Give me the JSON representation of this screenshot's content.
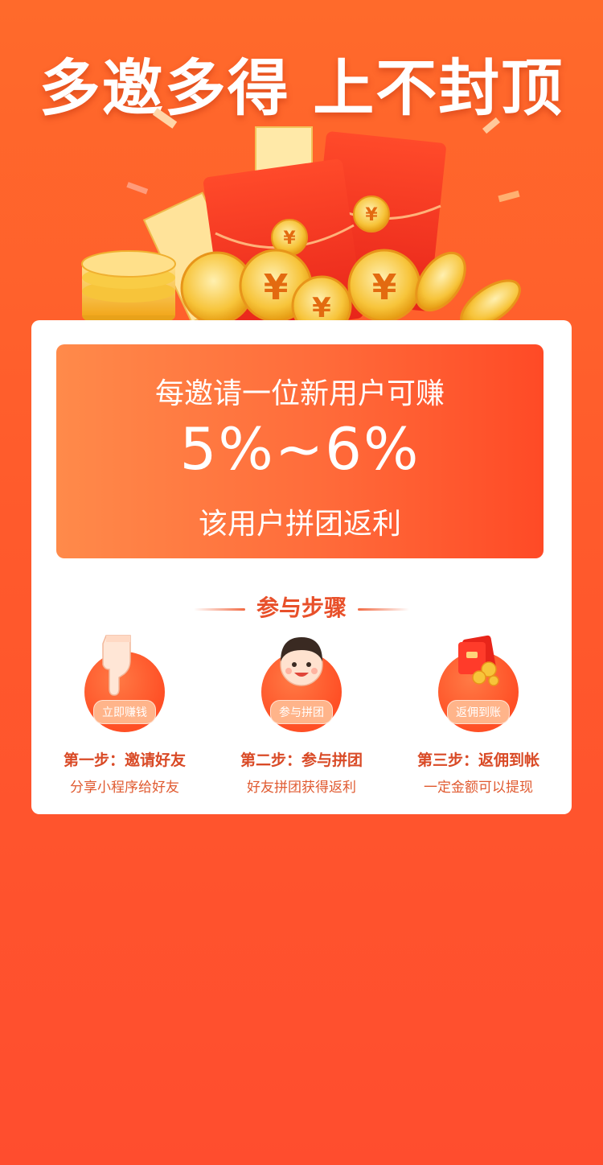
{
  "headline": "多邀多得 上不封顶",
  "banner": {
    "line1": "每邀请一位新用户可赚",
    "rate": "5%~6%",
    "line3": "该用户拼团返利"
  },
  "steps": {
    "title": "参与步骤",
    "items": [
      {
        "badge": "立即赚钱",
        "title": "第一步：邀请好友",
        "desc": "分享小程序给好友",
        "icon": "pointing-hand-icon"
      },
      {
        "badge": "参与拼团",
        "title": "第二步：参与拼团",
        "desc": "好友拼团获得返利",
        "icon": "boy-face-icon"
      },
      {
        "badge": "返佣到账",
        "title": "第三步：返佣到帐",
        "desc": "一定金额可以提现",
        "icon": "red-envelope-coins-icon"
      }
    ]
  },
  "colors": {
    "background": "#ff5a2c",
    "accent": "#e8502a",
    "card": "#ffffff"
  }
}
